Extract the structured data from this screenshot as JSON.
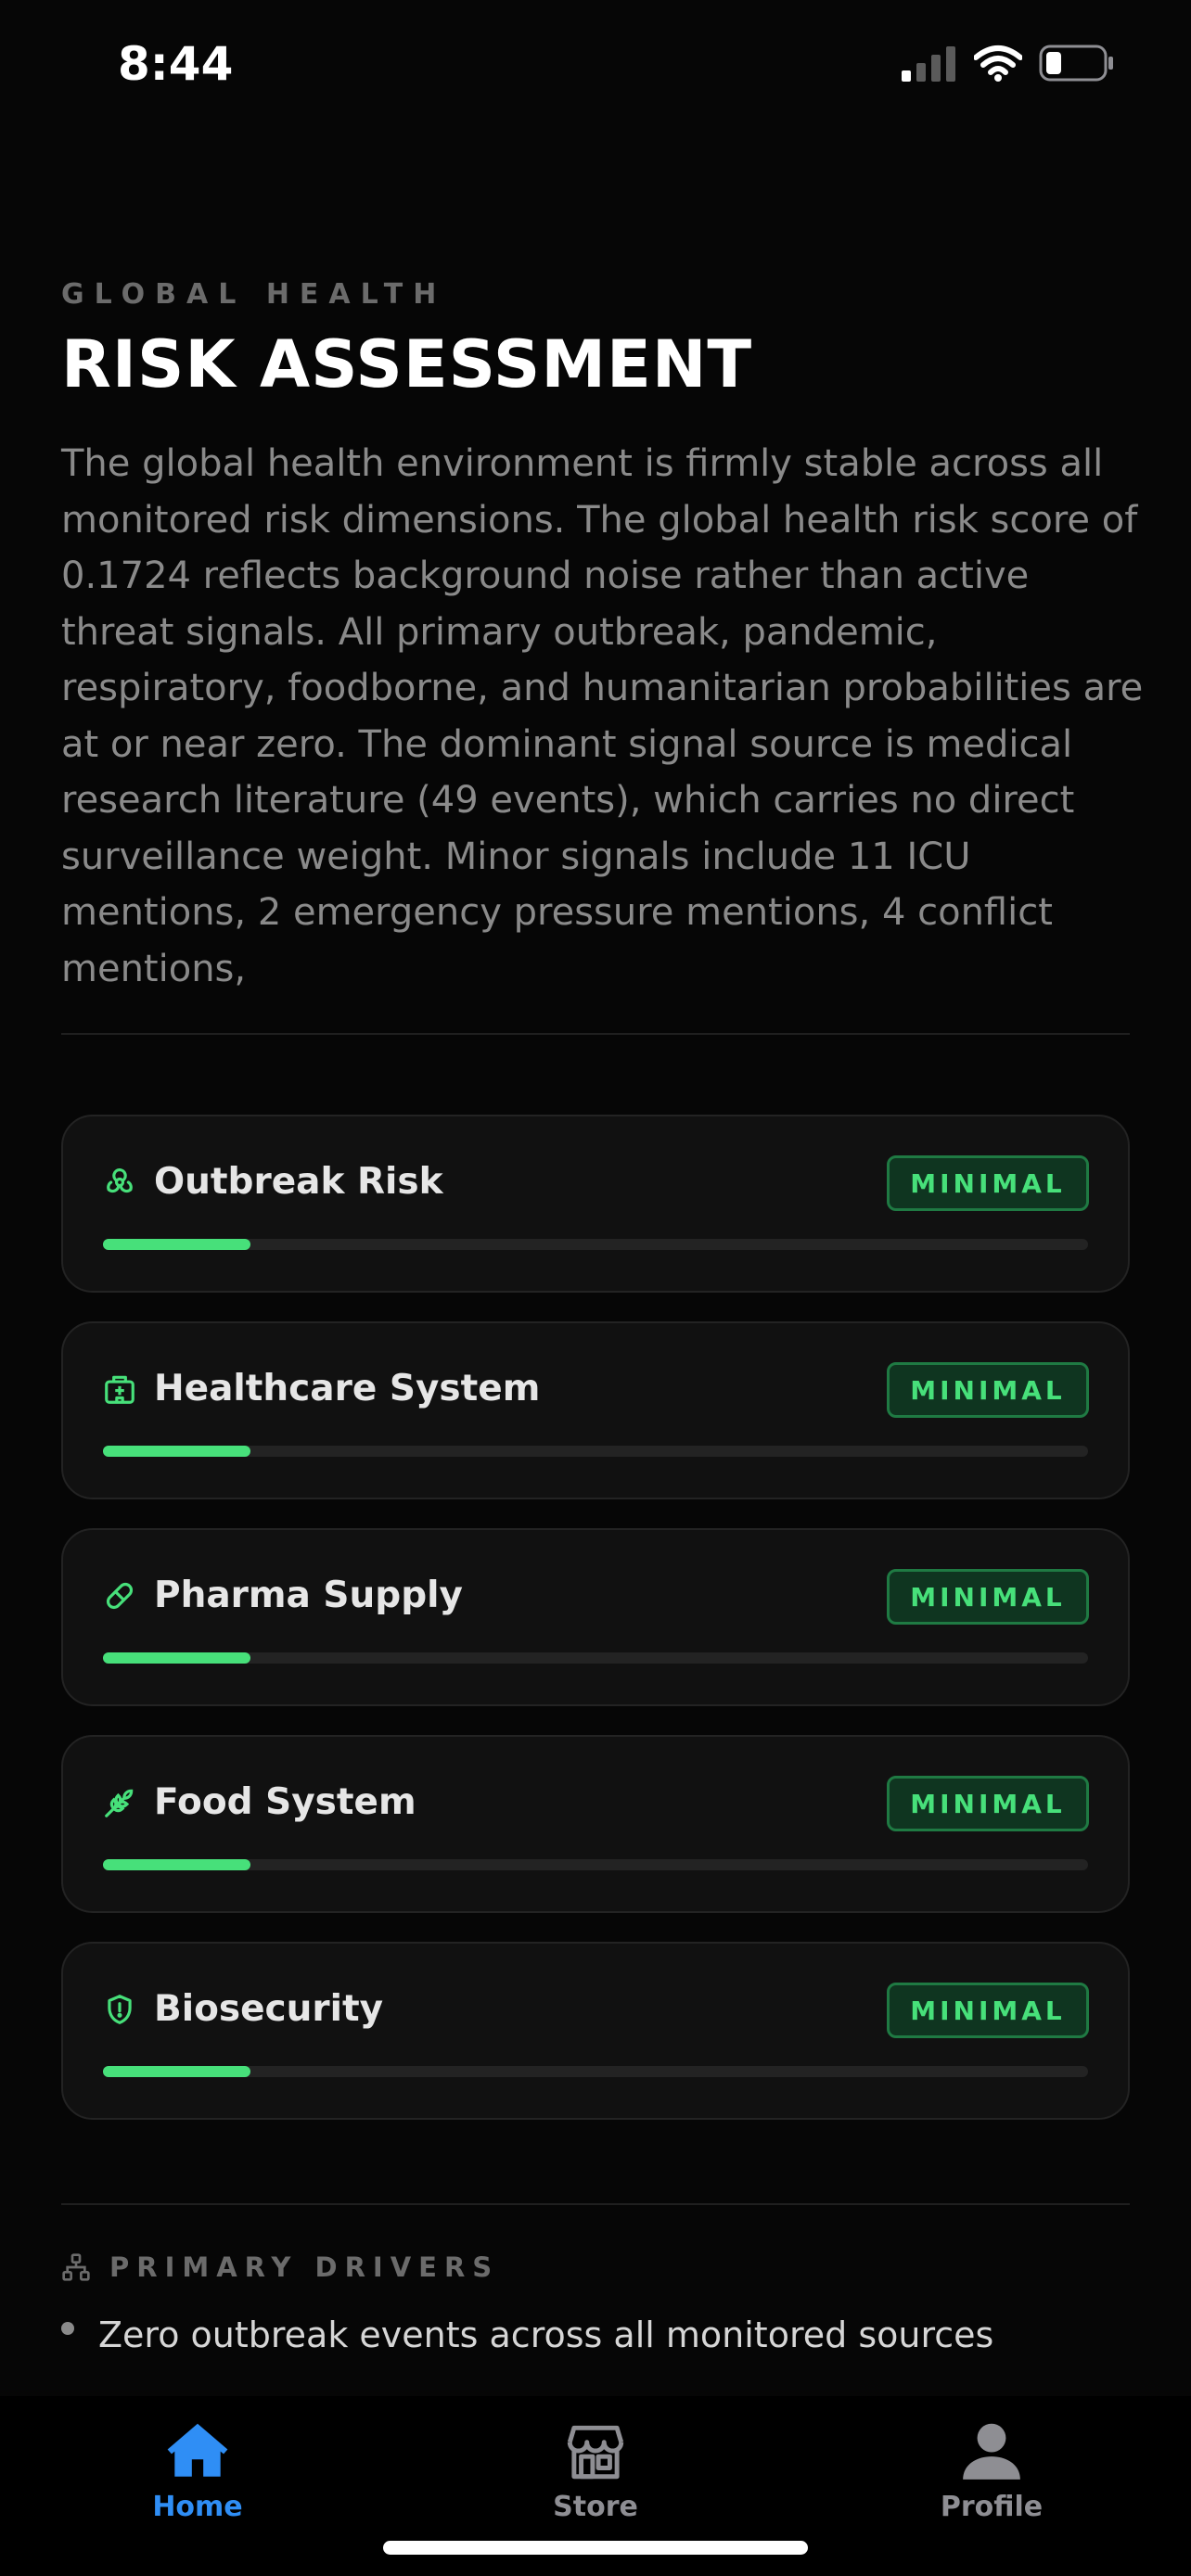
{
  "status_bar": {
    "time": "8:44"
  },
  "header": {
    "eyebrow": "GLOBAL HEALTH",
    "title": "RISK ASSESSMENT",
    "summary": "The global health environment is firmly stable across all monitored risk dimensions. The global health risk score of 0.1724 reflects background noise rather than active threat signals. All primary outbreak, pandemic, respiratory, foodborne, and humanitarian probabilities are at or near zero. The dominant signal source is medical research literature (49 events), which carries no direct surveillance weight. Minor signals include 11 ICU mentions, 2 emergency pressure mentions, 4 conflict mentions,"
  },
  "risk_cards": [
    {
      "title": "Outbreak Risk",
      "icon": "biohazard-icon",
      "badge": "MINIMAL",
      "level": 0.15
    },
    {
      "title": "Healthcare System",
      "icon": "hospital-icon",
      "badge": "MINIMAL",
      "level": 0.15
    },
    {
      "title": "Pharma Supply",
      "icon": "pill-icon",
      "badge": "MINIMAL",
      "level": 0.15
    },
    {
      "title": "Food System",
      "icon": "wheat-icon",
      "badge": "MINIMAL",
      "level": 0.15
    },
    {
      "title": "Biosecurity",
      "icon": "shield-alert-icon",
      "badge": "MINIMAL",
      "level": 0.15
    }
  ],
  "drivers": {
    "label": "PRIMARY DRIVERS",
    "icon": "network-icon",
    "items": [
      "Zero outbreak events across all monitored sources"
    ]
  },
  "tab_bar": {
    "tabs": [
      {
        "label": "Home",
        "icon": "house-icon",
        "active": true
      },
      {
        "label": "Store",
        "icon": "storefront-icon",
        "active": false
      },
      {
        "label": "Profile",
        "icon": "person-icon",
        "active": false
      }
    ]
  },
  "colors": {
    "background": "#060606",
    "card": "#111111",
    "accent_green": "#47e07a",
    "badge_bg": "#0f3520",
    "active_tab": "#2f8ef5",
    "inactive_tab": "#8e8e93"
  }
}
